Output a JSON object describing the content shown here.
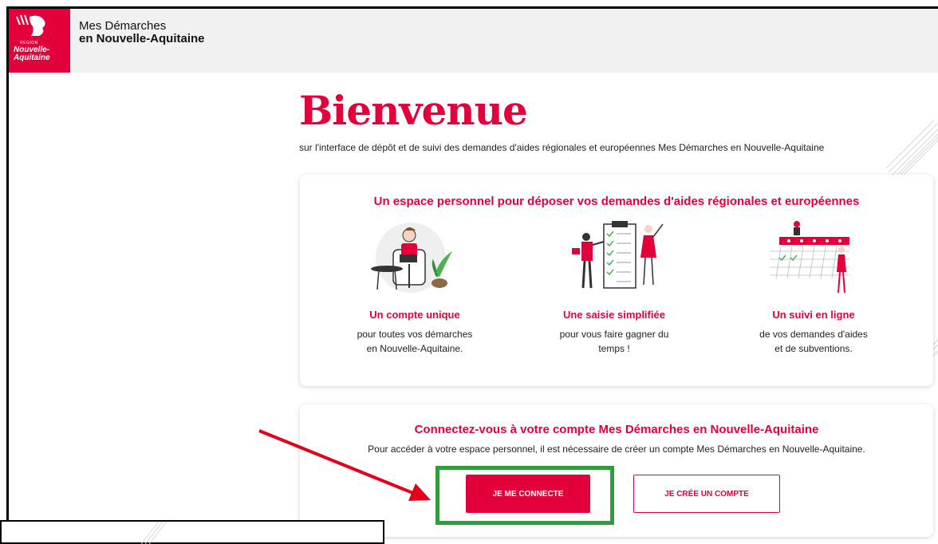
{
  "header": {
    "logo_small": "RÉGION",
    "logo_text_line1": "Nouvelle-",
    "logo_text_line2": "Aquitaine",
    "site_title_line1": "Mes Démarches",
    "site_title_line2": "en Nouvelle-Aquitaine"
  },
  "welcome": {
    "title": "Bienvenue",
    "subtitle": "sur l'interface de dépôt et de suivi des demandes d'aides régionales et européennes Mes Démarches en Nouvelle-Aquitaine"
  },
  "features_card": {
    "title": "Un espace personnel pour déposer vos demandes d'aides régionales et européennes",
    "items": [
      {
        "icon": "person-laptop-illustration",
        "title": "Un compte unique",
        "desc1": "pour toutes vos démarches",
        "desc2": "en Nouvelle-Aquitaine."
      },
      {
        "icon": "checklist-illustration",
        "title": "Une saisie simplifiée",
        "desc1": "pour vous faire gagner du",
        "desc2": "temps !"
      },
      {
        "icon": "calendar-illustration",
        "title": "Un suivi en ligne",
        "desc1": "de vos demandes d'aides",
        "desc2": "et de subventions."
      }
    ]
  },
  "connect_card": {
    "title": "Connectez-vous à votre compte Mes Démarches en Nouvelle-Aquitaine",
    "desc": "Pour accéder à votre espace personnel, il est nécessaire de créer un compte Mes Démarches en Nouvelle-Aquitaine.",
    "login_label": "JE ME CONNECTE",
    "signup_label": "JE CRÉE UN COMPTE"
  },
  "colors": {
    "brand": "#e4003a",
    "highlight": "#2f9e3a",
    "arrow": "#e4001b"
  }
}
